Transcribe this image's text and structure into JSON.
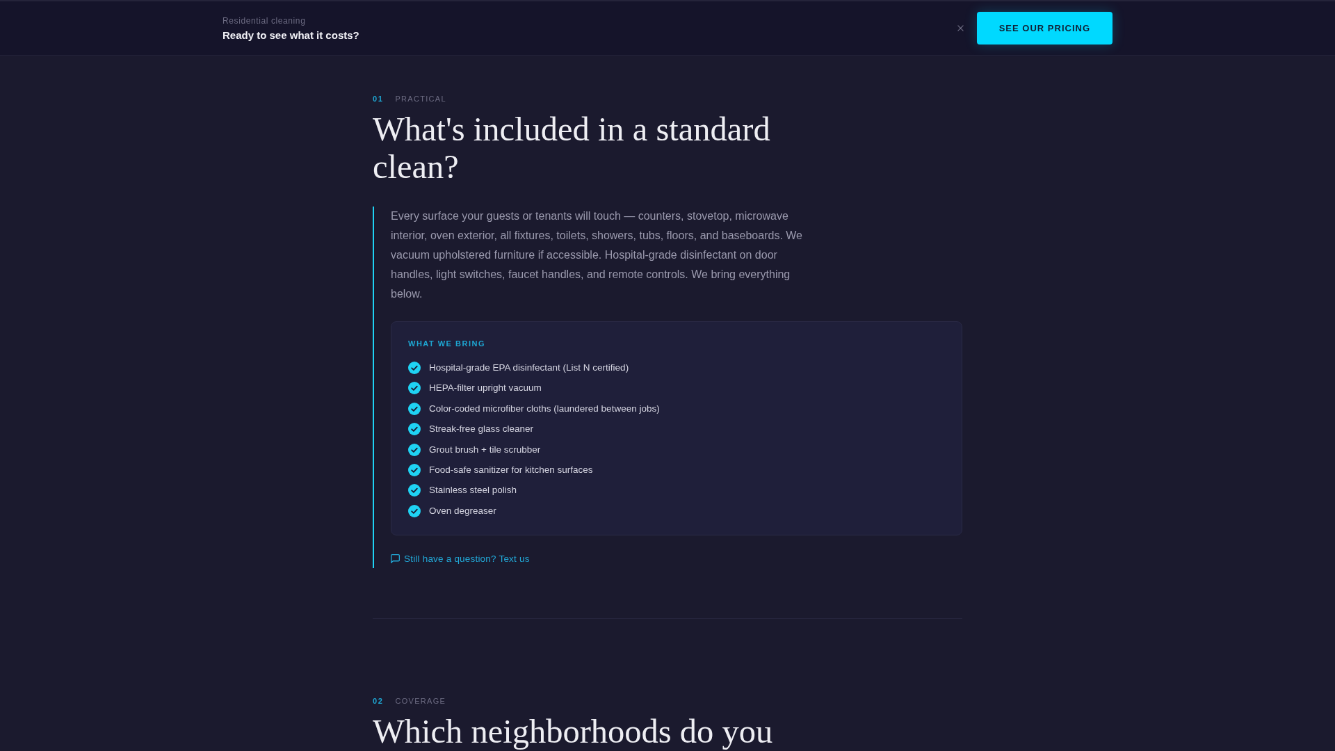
{
  "top_bar": {
    "eyebrow": "Residential cleaning",
    "title": "Ready to see what it costs?",
    "cta": "SEE OUR PRICING"
  },
  "sections": [
    {
      "number": "01",
      "category": "PRACTICAL",
      "title": "What's included in a standard clean?",
      "body": "Every surface your guests or tenants will touch — counters, stovetop, microwave interior, oven exterior, all fixtures, toilets, showers, tubs, floors, and baseboards. We vacuum upholstered furniture if accessible. Hospital-grade disinfectant on door handles, light switches, faucet handles, and remote controls. We bring everything below.",
      "checklist": {
        "title": "WHAT WE BRING",
        "items": [
          "Hospital-grade EPA disinfectant (List N certified)",
          "HEPA-filter upright vacuum",
          "Color-coded microfiber cloths (laundered between jobs)",
          "Streak-free glass cleaner",
          "Grout brush + tile scrubber",
          "Food-safe sanitizer for kitchen surfaces",
          "Stainless steel polish",
          "Oven degreaser"
        ]
      },
      "link": "Still have a question? Text us"
    },
    {
      "number": "02",
      "category": "COVERAGE",
      "title": "Which neighborhoods do you"
    }
  ]
}
